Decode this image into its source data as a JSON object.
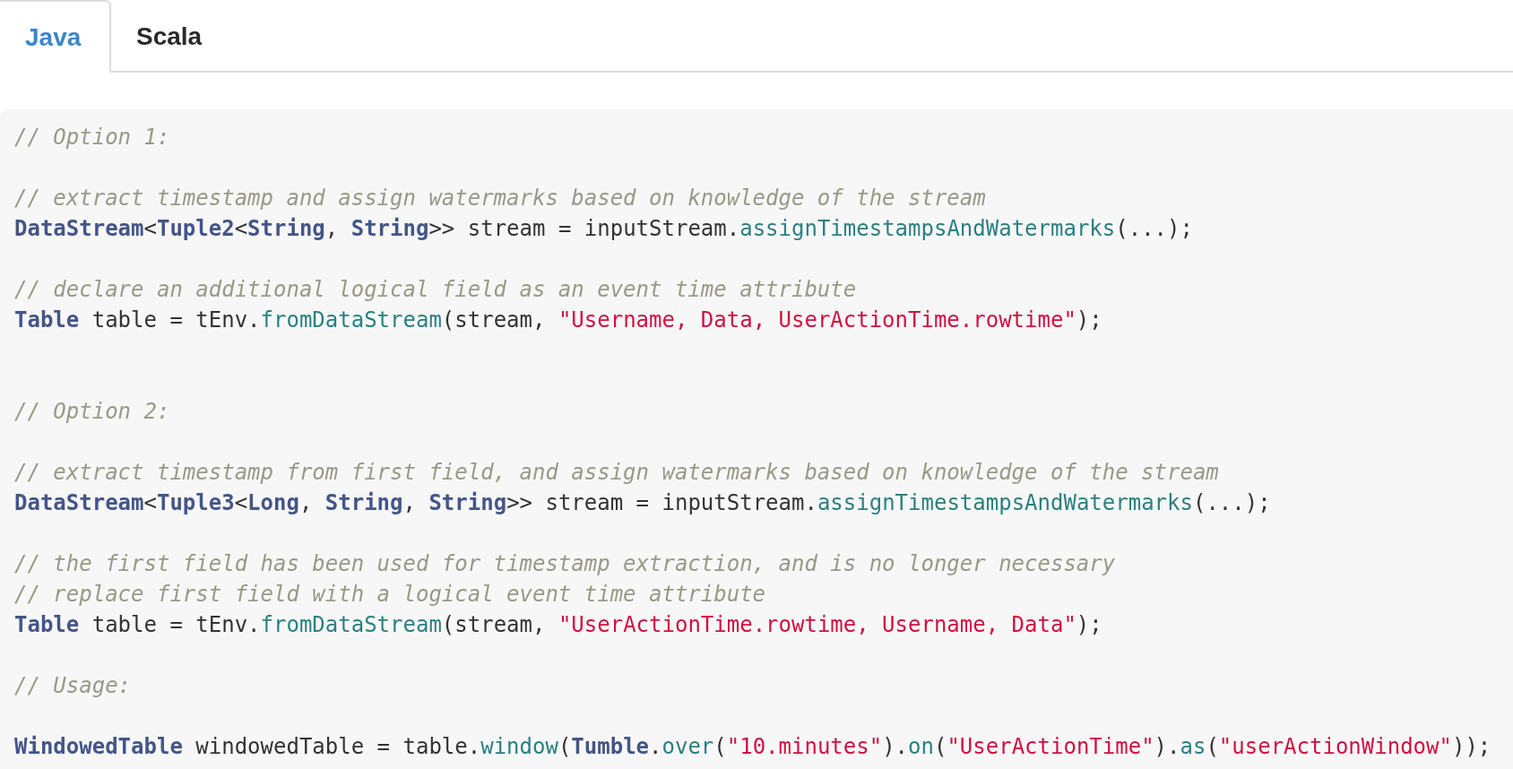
{
  "tabs": [
    {
      "label": "Java",
      "selected": true
    },
    {
      "label": "Scala",
      "selected": false
    }
  ],
  "code_lines": [
    {
      "kind": "code",
      "tokens": [
        {
          "kind": "comment",
          "text": "// Option 1:"
        }
      ]
    },
    {
      "kind": "blank"
    },
    {
      "kind": "code",
      "tokens": [
        {
          "kind": "comment",
          "text": "// extract timestamp and assign watermarks based on knowledge of the stream"
        }
      ]
    },
    {
      "kind": "code",
      "tokens": [
        {
          "kind": "type",
          "text": "DataStream"
        },
        {
          "kind": "plain",
          "text": "<"
        },
        {
          "kind": "type",
          "text": "Tuple2"
        },
        {
          "kind": "plain",
          "text": "<"
        },
        {
          "kind": "type",
          "text": "String"
        },
        {
          "kind": "plain",
          "text": ", "
        },
        {
          "kind": "type",
          "text": "String"
        },
        {
          "kind": "plain",
          "text": ">> stream = inputStream."
        },
        {
          "kind": "func",
          "text": "assignTimestampsAndWatermarks"
        },
        {
          "kind": "plain",
          "text": "(...);"
        }
      ]
    },
    {
      "kind": "blank"
    },
    {
      "kind": "code",
      "tokens": [
        {
          "kind": "comment",
          "text": "// declare an additional logical field as an event time attribute"
        }
      ]
    },
    {
      "kind": "code",
      "tokens": [
        {
          "kind": "type",
          "text": "Table"
        },
        {
          "kind": "plain",
          "text": " table = tEnv."
        },
        {
          "kind": "func",
          "text": "fromDataStream"
        },
        {
          "kind": "plain",
          "text": "(stream, "
        },
        {
          "kind": "string",
          "text": "\"Username, Data, UserActionTime.rowtime\""
        },
        {
          "kind": "plain",
          "text": ");"
        }
      ]
    },
    {
      "kind": "blank"
    },
    {
      "kind": "blank"
    },
    {
      "kind": "code",
      "tokens": [
        {
          "kind": "comment",
          "text": "// Option 2:"
        }
      ]
    },
    {
      "kind": "blank"
    },
    {
      "kind": "code",
      "tokens": [
        {
          "kind": "comment",
          "text": "// extract timestamp from first field, and assign watermarks based on knowledge of the stream"
        }
      ]
    },
    {
      "kind": "code",
      "tokens": [
        {
          "kind": "type",
          "text": "DataStream"
        },
        {
          "kind": "plain",
          "text": "<"
        },
        {
          "kind": "type",
          "text": "Tuple3"
        },
        {
          "kind": "plain",
          "text": "<"
        },
        {
          "kind": "type",
          "text": "Long"
        },
        {
          "kind": "plain",
          "text": ", "
        },
        {
          "kind": "type",
          "text": "String"
        },
        {
          "kind": "plain",
          "text": ", "
        },
        {
          "kind": "type",
          "text": "String"
        },
        {
          "kind": "plain",
          "text": ">> stream = inputStream."
        },
        {
          "kind": "func",
          "text": "assignTimestampsAndWatermarks"
        },
        {
          "kind": "plain",
          "text": "(...);"
        }
      ]
    },
    {
      "kind": "blank"
    },
    {
      "kind": "code",
      "tokens": [
        {
          "kind": "comment",
          "text": "// the first field has been used for timestamp extraction, and is no longer necessary"
        }
      ]
    },
    {
      "kind": "code",
      "tokens": [
        {
          "kind": "comment",
          "text": "// replace first field with a logical event time attribute"
        }
      ]
    },
    {
      "kind": "code",
      "tokens": [
        {
          "kind": "type",
          "text": "Table"
        },
        {
          "kind": "plain",
          "text": " table = tEnv."
        },
        {
          "kind": "func",
          "text": "fromDataStream"
        },
        {
          "kind": "plain",
          "text": "(stream, "
        },
        {
          "kind": "string",
          "text": "\"UserActionTime.rowtime, Username, Data\""
        },
        {
          "kind": "plain",
          "text": ");"
        }
      ]
    },
    {
      "kind": "blank"
    },
    {
      "kind": "code",
      "tokens": [
        {
          "kind": "comment",
          "text": "// Usage:"
        }
      ]
    },
    {
      "kind": "blank"
    },
    {
      "kind": "code",
      "tokens": [
        {
          "kind": "type",
          "text": "WindowedTable"
        },
        {
          "kind": "plain",
          "text": " windowedTable = table."
        },
        {
          "kind": "func",
          "text": "window"
        },
        {
          "kind": "plain",
          "text": "("
        },
        {
          "kind": "type",
          "text": "Tumble"
        },
        {
          "kind": "plain",
          "text": "."
        },
        {
          "kind": "func",
          "text": "over"
        },
        {
          "kind": "plain",
          "text": "("
        },
        {
          "kind": "string",
          "text": "\"10.minutes\""
        },
        {
          "kind": "plain",
          "text": ")."
        },
        {
          "kind": "func",
          "text": "on"
        },
        {
          "kind": "plain",
          "text": "("
        },
        {
          "kind": "string",
          "text": "\"UserActionTime\""
        },
        {
          "kind": "plain",
          "text": ")."
        },
        {
          "kind": "func",
          "text": "as"
        },
        {
          "kind": "plain",
          "text": "("
        },
        {
          "kind": "string",
          "text": "\"userActionWindow\""
        },
        {
          "kind": "plain",
          "text": "));"
        }
      ]
    }
  ]
}
